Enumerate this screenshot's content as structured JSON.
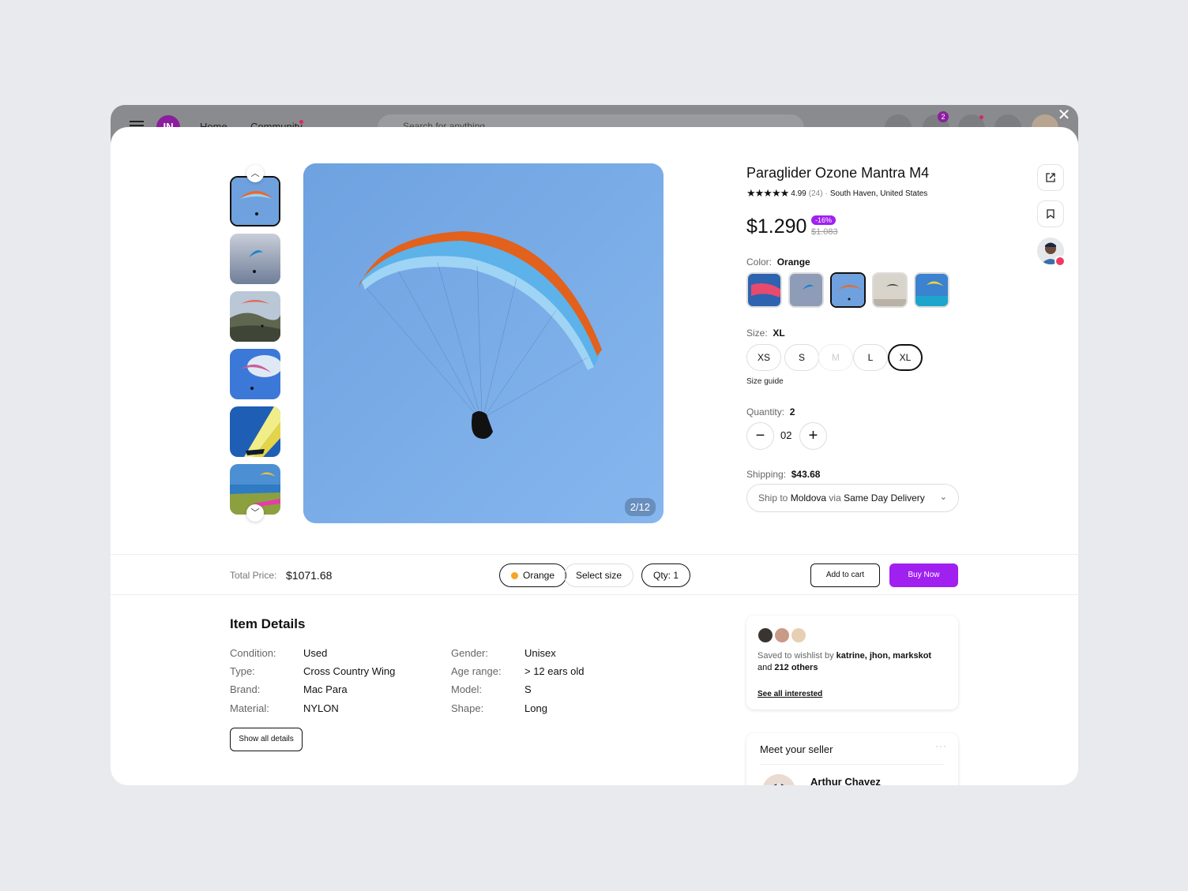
{
  "background_app": {
    "logo": "IN",
    "nav_home": "Home",
    "nav_community": "Community",
    "search_placeholder": "Search for anything",
    "cart_count": "2"
  },
  "product": {
    "title": "Paraglider Ozone Mantra M4",
    "rating": "4.99",
    "reviews": "(24)",
    "location": "South Haven, United States",
    "price": "$1.290",
    "discount": "-16%",
    "old_price": "$1.083",
    "image_counter": "2/12",
    "color_label": "Color:",
    "color_value": "Orange",
    "size_label": "Size:",
    "size_value": "XL",
    "sizes": [
      "XS",
      "S",
      "M",
      "L",
      "XL"
    ],
    "size_guide": "Size guide",
    "quantity_label": "Quantity:",
    "quantity_value": "2",
    "quantity_display": "02",
    "shipping_label": "Shipping:",
    "shipping_value": "$43.68",
    "ship_to_prefix": "Ship to",
    "ship_country": "Moldova",
    "ship_via": "via",
    "ship_method": "Same Day Delivery"
  },
  "sticky_bar": {
    "total_label": "Total Price:",
    "total_value": "$1071.68",
    "color_pill": "Orange",
    "size_pill": "Select size",
    "qty_pill": "Qty: 1",
    "add_to_cart": "Add to cart",
    "buy_now": "Buy Now"
  },
  "details": {
    "title": "Item Details",
    "rows_left": [
      {
        "label": "Condition:",
        "value": "Used"
      },
      {
        "label": "Type:",
        "value": "Cross Country Wing"
      },
      {
        "label": "Brand:",
        "value": "Mac Para"
      },
      {
        "label": "Material:",
        "value": "NYLON"
      }
    ],
    "rows_right": [
      {
        "label": "Gender:",
        "value": "Unisex"
      },
      {
        "label": "Age range:",
        "value": "> 12 ears old"
      },
      {
        "label": "Model:",
        "value": "S"
      },
      {
        "label": "Shape:",
        "value": "Long"
      }
    ],
    "show_all": "Show all details"
  },
  "wishlist": {
    "prefix": "Saved to wishlist by",
    "names": "katrine, jhon, markskot",
    "and": "and",
    "others": "212 others",
    "see_all": "See all interested"
  },
  "seller": {
    "heading": "Meet your seller",
    "name": "Arthur Chavez"
  },
  "colors": {
    "accent": "#a020f0",
    "sky": "#7aaae3",
    "orange_dot": "#f5a524",
    "notification": "#f03a5f"
  }
}
